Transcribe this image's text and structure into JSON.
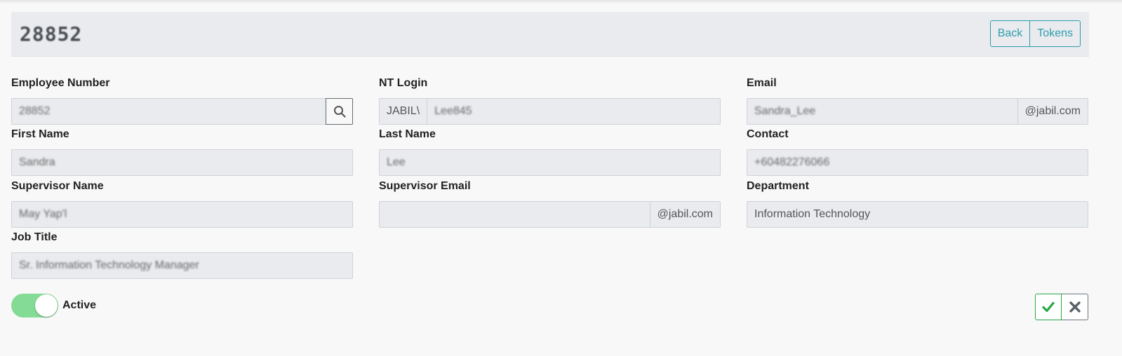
{
  "header": {
    "title": "28852",
    "back_label": "Back",
    "tokens_label": "Tokens"
  },
  "fields": {
    "employee_number": {
      "label": "Employee Number",
      "value": "28852"
    },
    "nt_login": {
      "label": "NT Login",
      "prefix": "JABIL\\",
      "value": "Lee845"
    },
    "email": {
      "label": "Email",
      "value": "Sandra_Lee",
      "suffix": "@jabil.com"
    },
    "first_name": {
      "label": "First Name",
      "value": "Sandra"
    },
    "last_name": {
      "label": "Last Name",
      "value": "Lee"
    },
    "contact": {
      "label": "Contact",
      "value": "+60482276066"
    },
    "supervisor_name": {
      "label": "Supervisor Name",
      "value": "May Yap'l"
    },
    "supervisor_email": {
      "label": "Supervisor Email",
      "value": "",
      "suffix": "@jabil.com"
    },
    "department": {
      "label": "Department",
      "value": "Information Technology"
    },
    "job_title": {
      "label": "Job Title",
      "value": "Sr. Information Technology Manager"
    }
  },
  "status": {
    "active_label": "Active",
    "active": true
  },
  "colors": {
    "accent": "#2f9dae",
    "toggle_on": "#84db95",
    "confirm": "#28a745",
    "cancel": "#6c757d"
  },
  "icons": {
    "search": "search-icon",
    "confirm": "check-icon",
    "cancel": "close-icon"
  }
}
